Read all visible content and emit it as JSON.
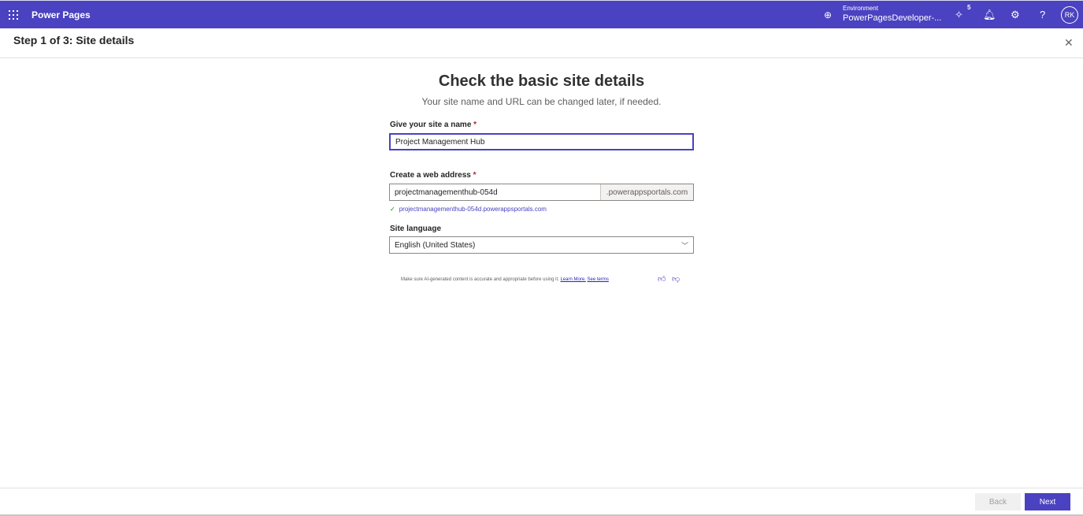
{
  "header": {
    "app_name": "Power Pages",
    "environment_label": "Environment",
    "environment_value": "PowerPagesDeveloper-...",
    "notification_badge": "5",
    "avatar_initials": "RK",
    "accent": "#4a42c0"
  },
  "step": {
    "title": "Step 1 of 3: Site details"
  },
  "form": {
    "title": "Check the basic site details",
    "subtitle": "Your site name and URL can be changed later, if needed.",
    "name_label": "Give your site a name",
    "required": "*",
    "name_value": "Project Management Hub",
    "address_label": "Create a web address",
    "address_value": "projectmanagementhub-054d",
    "address_suffix": ".powerappsportals.com",
    "address_validation": "projectmanagementhub-054d.powerappsportals.com",
    "language_label": "Site language",
    "language_value": "English (United States)"
  },
  "ai": {
    "notice": "Make sure AI-generated content is accurate and appropriate before using it.",
    "learn_more": "Learn More.",
    "see_terms": "See terms"
  },
  "footer": {
    "back": "Back",
    "next": "Next"
  }
}
